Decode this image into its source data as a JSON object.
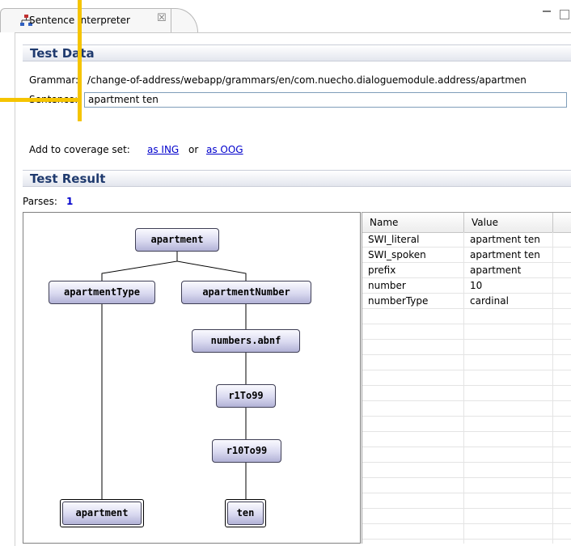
{
  "tab": {
    "title": "Sentence Interpreter",
    "close": "☒"
  },
  "sections": {
    "test_data": "Test Data",
    "test_result": "Test Result"
  },
  "grammar": {
    "label": "Grammar:",
    "value": "/change-of-address/webapp/grammars/en/com.nuecho.dialoguemodule.address/apartmen"
  },
  "sentence": {
    "label": "Sentence:",
    "value": "apartment ten"
  },
  "coverage": {
    "label": "Add to coverage set:",
    "as_ing": "as ING",
    "or": "or",
    "as_oog": "as OOG"
  },
  "parses": {
    "label": "Parses:",
    "count": "1"
  },
  "tree": {
    "root": "apartment",
    "apartment_type": "apartmentType",
    "apartment_number": "apartmentNumber",
    "numbers_abnf": "numbers.abnf",
    "r1to99": "r1To99",
    "r10to99": "r10To99",
    "leaf_apartment": "apartment",
    "leaf_ten": "ten"
  },
  "table": {
    "headers": [
      "Name",
      "Value"
    ],
    "rows": [
      [
        "SWI_literal",
        "apartment ten"
      ],
      [
        "SWI_spoken",
        "apartment ten"
      ],
      [
        "prefix",
        "apartment"
      ],
      [
        "number",
        "10"
      ],
      [
        "numberType",
        "cardinal"
      ]
    ]
  },
  "colors": {
    "section_text": "#1f3a6e",
    "callout": "#f5c400",
    "link": "#0000cc"
  }
}
